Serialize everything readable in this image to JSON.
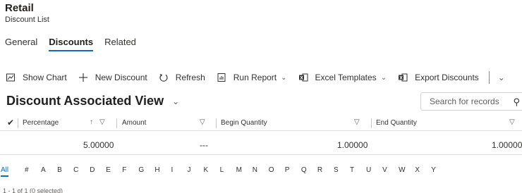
{
  "header": {
    "title": "Retail",
    "subtitle": "Discount List"
  },
  "tabs": [
    {
      "label": "General",
      "active": false
    },
    {
      "label": "Discounts",
      "active": true
    },
    {
      "label": "Related",
      "active": false
    }
  ],
  "commandbar": {
    "show_chart": {
      "label": "Show Chart",
      "icon": "chart-icon"
    },
    "new_discount": {
      "label": "New Discount",
      "icon": "plus-icon"
    },
    "refresh": {
      "label": "Refresh",
      "icon": "refresh-icon"
    },
    "run_report": {
      "label": "Run Report",
      "icon": "report-icon"
    },
    "excel_templates": {
      "label": "Excel Templates",
      "icon": "excel-icon"
    },
    "export_discounts": {
      "label": "Export Discounts",
      "icon": "export-excel-icon"
    }
  },
  "view": {
    "title": "Discount Associated View"
  },
  "search": {
    "placeholder": "Search for records"
  },
  "grid": {
    "columns": [
      "Percentage",
      "Amount",
      "Begin Quantity",
      "End Quantity"
    ],
    "rows": [
      {
        "percentage": "5.00000",
        "amount": "---",
        "begin_quantity": "1.00000",
        "end_quantity": "1.00000"
      }
    ]
  },
  "jumpbar": [
    "All",
    "#",
    "A",
    "B",
    "C",
    "D",
    "E",
    "F",
    "G",
    "H",
    "I",
    "J",
    "K",
    "L",
    "M",
    "N",
    "O",
    "P",
    "Q",
    "R",
    "S",
    "T",
    "U",
    "V",
    "W",
    "X",
    "Y"
  ],
  "colors": {
    "accent": "#0f6cbd"
  }
}
